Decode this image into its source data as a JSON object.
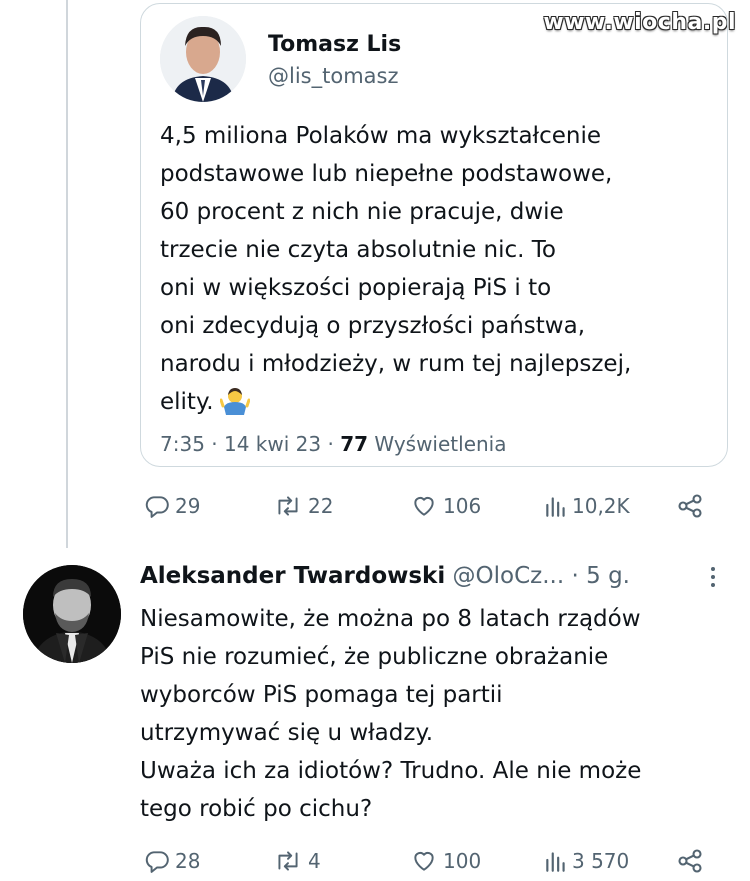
{
  "watermark": "www.wiocha.pl",
  "quoted_tweet": {
    "author_name": "Tomasz Lis",
    "author_handle": "@lis_tomasz",
    "text": "4,5 miliona Polaków ma wykształcenie\npodstawowe lub niepełne podstawowe,\n60 procent z nich nie pracuje, dwie\ntrzecie nie czyta absolutnie nic. To\noni w większości popierają PiS  i to\noni zdecydują o przyszłości państwa,\nnarodu i młodzieży, w rum tej najlepszej,\nelity.",
    "emoji": "person-shrugging-emoji",
    "time": "7:35",
    "date": "14 kwi 23",
    "views_count": "77",
    "views_label": "Wyświetlenia",
    "sep": "·"
  },
  "main_tweet_actions": {
    "replies": "29",
    "retweets": "22",
    "likes": "106",
    "views": "10,2K"
  },
  "reply": {
    "author_name": "Aleksander Twardowski",
    "author_handle": "@OloCz...",
    "time": "· 5 g.",
    "text": "Niesamowite, że można po 8 latach rządów\nPiS nie rozumieć, że publiczne obrażanie\nwyborców PiS pomaga tej partii\nutrzymywać się u władzy.\nUważa ich za idiotów? Trudno. Ale nie może\ntego robić po cichu?",
    "actions": {
      "replies": "28",
      "retweets": "4",
      "likes": "100",
      "views": "3 570"
    }
  },
  "colors": {
    "text": "#0f1419",
    "muted": "#536471",
    "border": "#cfd9de"
  },
  "icons": [
    "reply-icon",
    "retweet-icon",
    "like-icon",
    "views-icon",
    "share-icon",
    "more-icon"
  ]
}
